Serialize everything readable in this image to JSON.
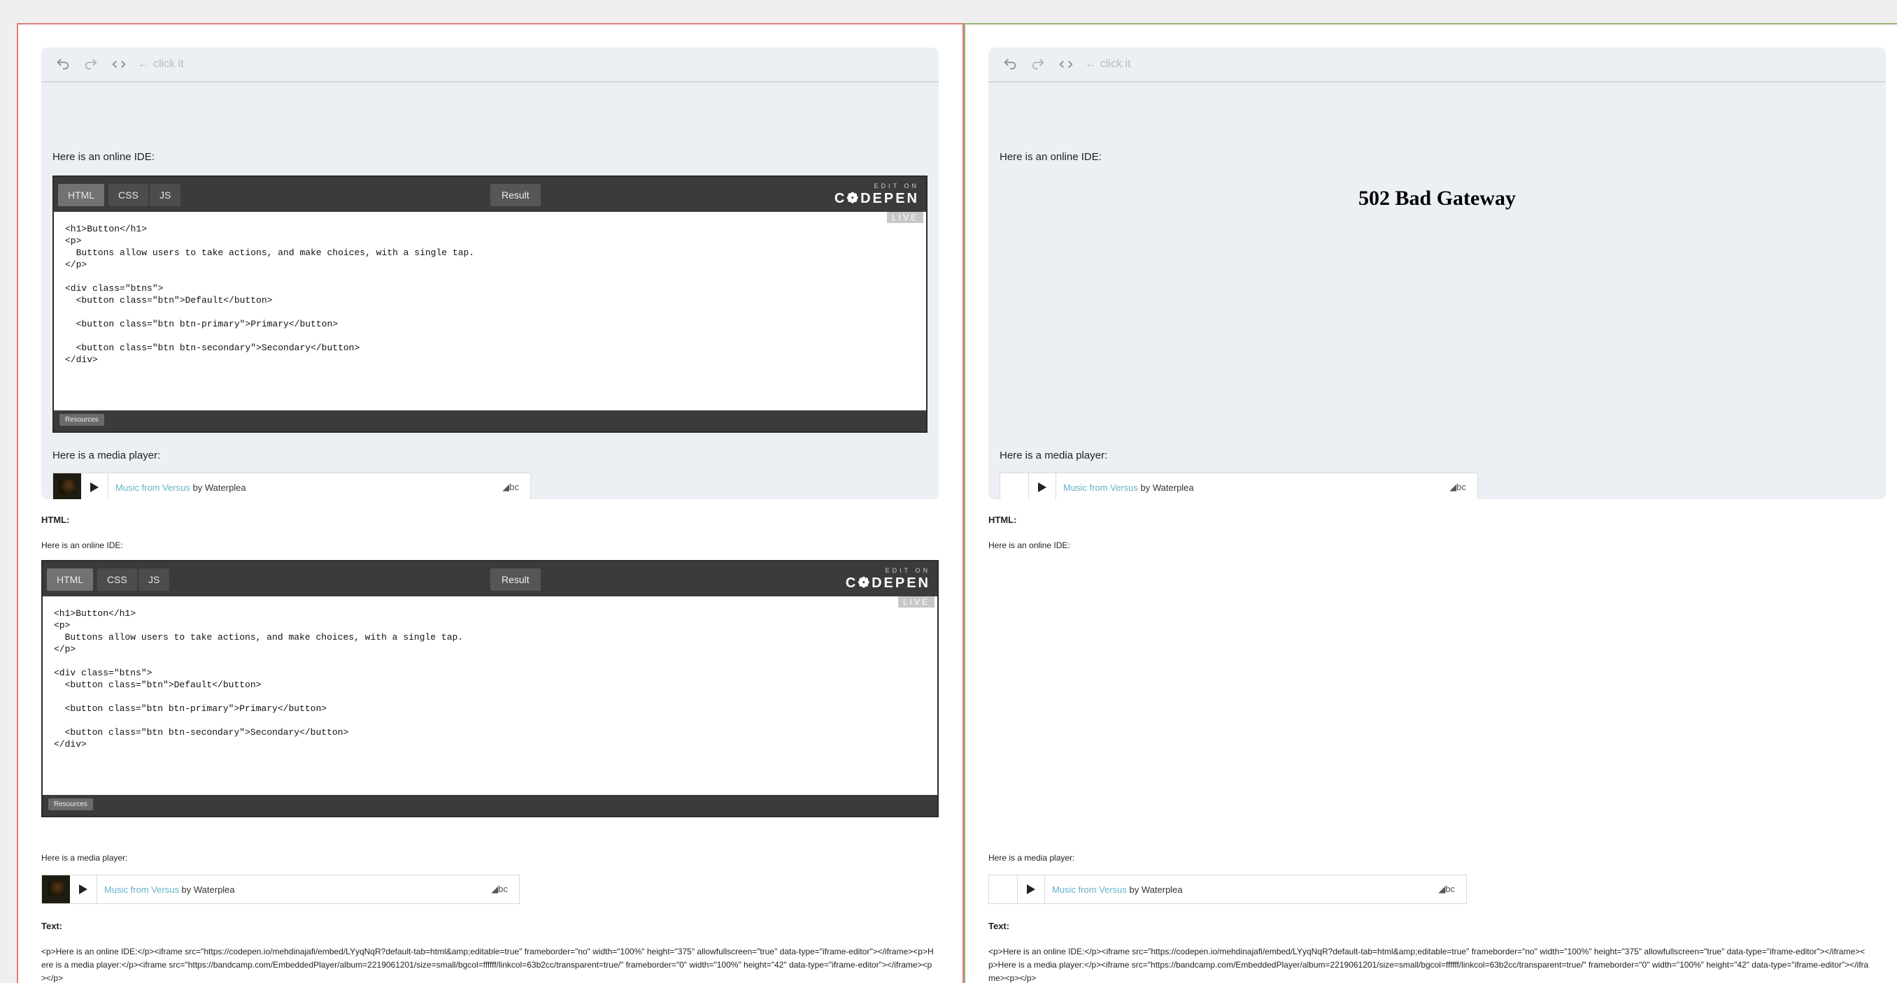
{
  "toolbar": {
    "click_hint": "click it"
  },
  "left": {
    "ide_intro": "Here is an online IDE:",
    "media_intro": "Here is a media player:"
  },
  "right": {
    "ide_intro": "Here is an online IDE:",
    "media_intro": "Here is a media player:",
    "error_title": "502 Bad Gateway"
  },
  "codepen": {
    "tabs": [
      "HTML",
      "CSS",
      "JS"
    ],
    "result_label": "Result",
    "brand_top": "EDIT ON",
    "brand_word": "C❁DEPEN",
    "live_badge": "LIVE",
    "resources_label": "Resources",
    "code": "<h1>Button</h1>\n<p>\n  Buttons allow users to take actions, and make choices, with a single tap.\n</p>\n\n<div class=\"btns\">\n  <button class=\"btn\">Default</button>\n\n  <button class=\"btn btn-primary\">Primary</button>\n\n  <button class=\"btn btn-secondary\">Secondary</button>\n</div>"
  },
  "player": {
    "link_text": "Music from Versus",
    "by_text": " by Waterplea",
    "brand": "bc"
  },
  "sections": {
    "html_label": "HTML:",
    "text_label": "Text:"
  },
  "raw_text": "<p>Here is an online IDE:</p><iframe src=\"https://codepen.io/mehdinajafi/embed/LYyqNqR?default-tab=html&amp;editable=true\" frameborder=\"no\" width=\"100%\" height=\"375\" allowfullscreen=\"true\" data-type=\"iframe-editor\"></iframe><p>Here is a media player:</p><iframe src=\"https://bandcamp.com/EmbeddedPlayer/album=2219061201/size=small/bgcol=ffffff/linkcol=63b2cc/transparent=true/\" frameborder=\"0\" width=\"100%\" height=\"42\" data-type=\"iframe-editor\"></iframe><p></p>",
  "colors": {
    "left_border": "#e07a7a",
    "right_border": "#9ab37a",
    "link": "#63b2cc"
  }
}
